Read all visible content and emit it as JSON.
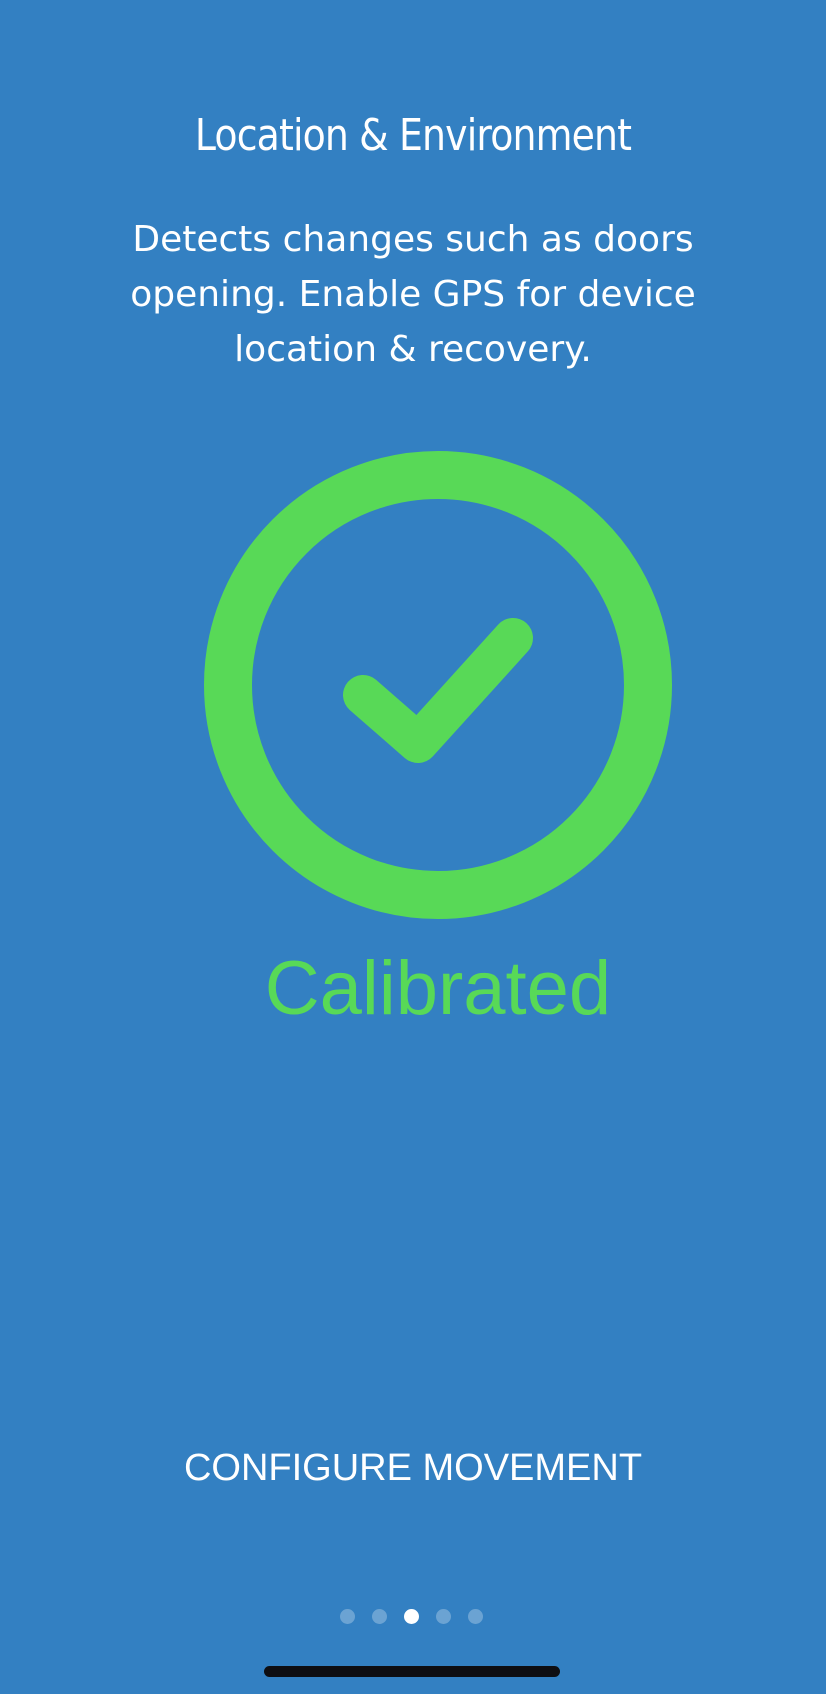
{
  "header": {
    "title": "Location & Environment",
    "description": "Detects changes such as doors opening. Enable GPS for device location & recovery."
  },
  "status": {
    "icon": "check-circle-icon",
    "label": "Calibrated",
    "color": "#58d957"
  },
  "actions": {
    "configure_label": "CONFIGURE MOVEMENT"
  },
  "pagination": {
    "total_pages": 5,
    "current_page": 3
  },
  "colors": {
    "background": "#3380c2",
    "accent": "#58d957",
    "text": "#ffffff"
  }
}
